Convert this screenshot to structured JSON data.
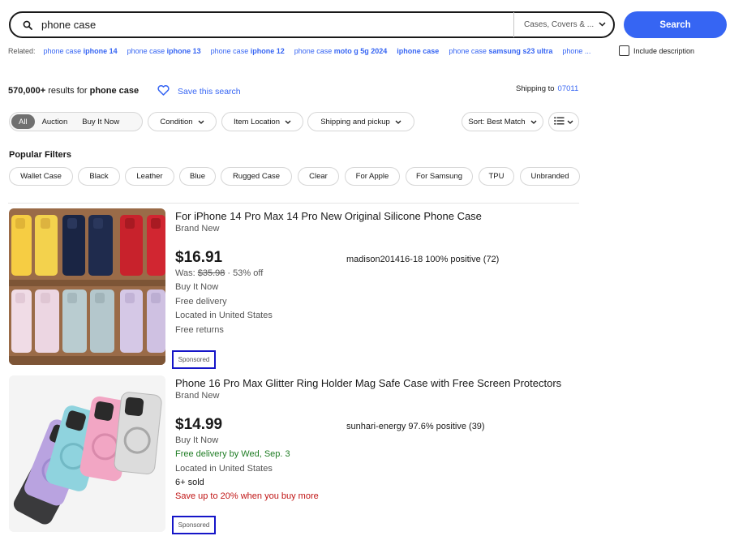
{
  "search": {
    "query": "phone case",
    "category": "Cases, Covers & ...",
    "button": "Search"
  },
  "related": {
    "label": "Related:",
    "items": [
      {
        "plain": "phone case ",
        "bold": "iphone 14"
      },
      {
        "plain": "phone case ",
        "bold": "iphone 13"
      },
      {
        "plain": "phone case ",
        "bold": "iphone 12"
      },
      {
        "plain": "phone case ",
        "bold": "moto g 5g 2024"
      },
      {
        "plain": "",
        "bold": "iphone case"
      },
      {
        "plain": "phone case ",
        "bold": "samsung s23 ultra"
      },
      {
        "plain": "phone ...",
        "bold": ""
      }
    ],
    "include_description": "Include description"
  },
  "results": {
    "count": "570,000+",
    "count_suffix": " results for ",
    "query": "phone case",
    "save_search": "Save this search",
    "shipping_label": "Shipping to",
    "zip": "07011"
  },
  "filters": {
    "format": [
      "All",
      "Auction",
      "Buy It Now"
    ],
    "dropdowns": [
      "Condition",
      "Item Location",
      "Shipping and pickup"
    ],
    "sort": "Sort: Best Match"
  },
  "popular_filters": {
    "title": "Popular Filters",
    "items": [
      "Wallet Case",
      "Black",
      "Leather",
      "Blue",
      "Rugged Case",
      "Clear",
      "For Apple",
      "For Samsung",
      "TPU",
      "Unbranded"
    ]
  },
  "listings": [
    {
      "title": "For iPhone 14 Pro Max 14 Pro New Original Silicone Phone Case",
      "condition": "Brand New",
      "price": "$16.91",
      "was_label": "Was: ",
      "was_price": "$35.98",
      "discount": " · 53% off",
      "buy_format": "Buy It Now",
      "delivery": "Free delivery",
      "location": "Located in United States",
      "returns": "Free returns",
      "seller": "madison201416-18 100% positive (72)",
      "sponsored": "Sponsored"
    },
    {
      "title": "Phone 16 Pro Max Glitter Ring Holder Mag Safe Case with Free Screen Protectors",
      "condition": "Brand New",
      "price": "$14.99",
      "buy_format": "Buy It Now",
      "delivery": "Free delivery by Wed, Sep. 3",
      "location": "Located in United States",
      "sold": "6+ sold",
      "promo": "Save up to 20% when you buy more",
      "seller": "sunhari-energy 97.6% positive (39)",
      "sponsored": "Sponsored"
    }
  ],
  "colors": {
    "accent": "#3665f3",
    "green": "#1e7c23",
    "red": "#c01515",
    "sponsored_border": "#1515c8"
  }
}
